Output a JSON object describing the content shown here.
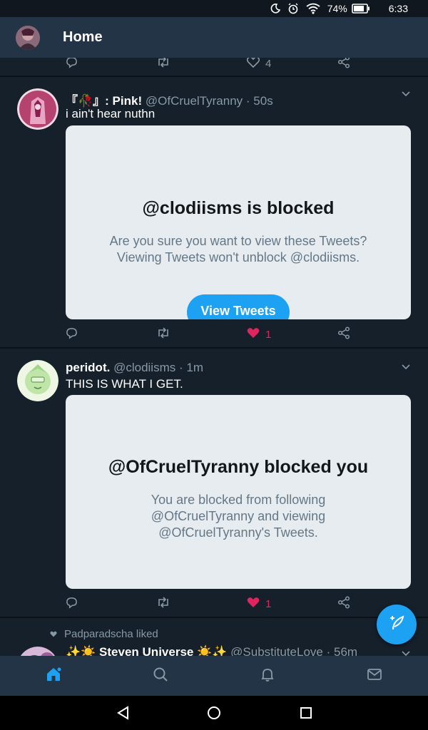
{
  "status": {
    "battery": "74%",
    "time": "6:33"
  },
  "header": {
    "title": "Home"
  },
  "top_actions": {
    "like_count": "4"
  },
  "tweet1": {
    "name": "『🥀』: Pink!",
    "handle": "@OfCruelTyranny",
    "time": "· 50s",
    "text": "i ain't hear nuthn",
    "card": {
      "title": "@clodiisms is blocked",
      "body": "Are you sure you want to view these Tweets? Viewing Tweets won't unblock @clodiisms.",
      "button": "View Tweets"
    },
    "like_count": "1",
    "liked": true
  },
  "tweet2": {
    "name": "peridot.",
    "handle": "@clodiisms",
    "time": "· 1m",
    "text": "THIS IS WHAT I GET.",
    "card": {
      "title": "@OfCruelTyranny blocked you",
      "body": "You are blocked from following @OfCruelTyranny and viewing @OfCruelTyranny's Tweets."
    },
    "like_count": "1",
    "liked": true
  },
  "tweet3": {
    "context": "Padparadscha liked",
    "name": "✨☀️ Steven Universe ☀️✨",
    "handle": "@SubstitutеLove",
    "time": "· 56m"
  },
  "colors": {
    "background": "#15202b",
    "bar": "#243447",
    "accent": "#1da1f2",
    "like": "#e0245e",
    "muted": "#8899a6"
  },
  "icons": [
    "reply-icon",
    "retweet-icon",
    "like-icon",
    "share-icon",
    "compose-icon",
    "home-icon",
    "search-icon",
    "notifications-icon",
    "messages-icon"
  ]
}
